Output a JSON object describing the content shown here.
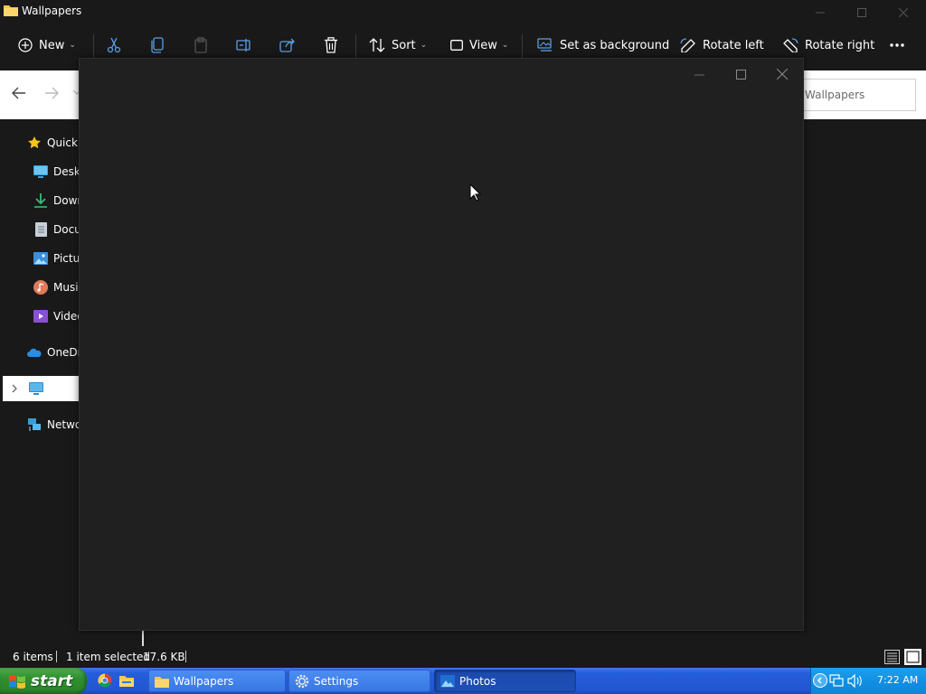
{
  "explorer": {
    "title": "Wallpapers",
    "toolbar": {
      "new_label": "New",
      "sort_label": "Sort",
      "view_label": "View",
      "set_background_label": "Set as background",
      "rotate_left_label": "Rotate left",
      "rotate_right_label": "Rotate right"
    },
    "address": {
      "search_placeholder": "Wallpapers"
    },
    "nav": {
      "items": [
        {
          "label": "Quick access",
          "icon": "star-icon"
        },
        {
          "label": "Desktop",
          "icon": "desktop-icon"
        },
        {
          "label": "Downloads",
          "icon": "download-icon"
        },
        {
          "label": "Documents",
          "icon": "document-icon"
        },
        {
          "label": "Pictures",
          "icon": "pictures-icon"
        },
        {
          "label": "Music",
          "icon": "music-icon"
        },
        {
          "label": "Videos",
          "icon": "videos-icon"
        },
        {
          "label": "OneDrive",
          "icon": "cloud-icon"
        },
        {
          "label": "",
          "icon": "this-pc-icon"
        },
        {
          "label": "Network",
          "icon": "network-icon"
        }
      ]
    },
    "status": {
      "items_count": "6 items",
      "selection": "1 item selected",
      "size": "17.6 KB"
    }
  },
  "photos_window": {
    "title": ""
  },
  "taskbar": {
    "start_label": "start",
    "tasks": [
      {
        "label": "Wallpapers",
        "icon": "folder-icon",
        "active": false
      },
      {
        "label": "Settings",
        "icon": "gear-icon",
        "active": false
      },
      {
        "label": "Photos",
        "icon": "photos-icon",
        "active": true
      }
    ],
    "clock": "7:22 AM"
  },
  "colors": {
    "explorer_bg": "#191919",
    "photos_bg": "#202020",
    "taskbar_blue": "#245edb",
    "start_green": "#2f8f2f",
    "tray_blue": "#1290e2"
  }
}
